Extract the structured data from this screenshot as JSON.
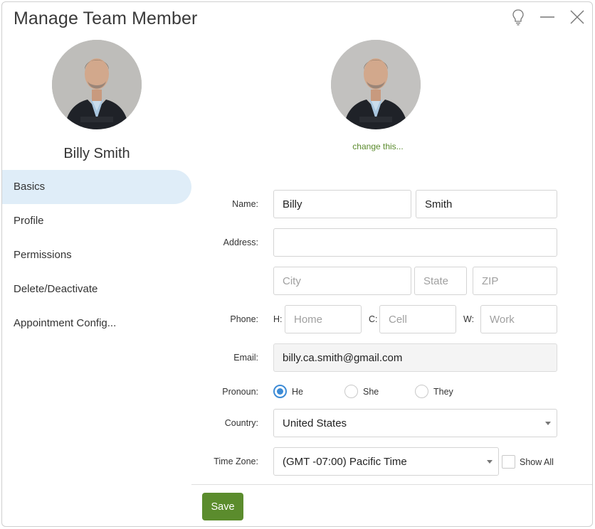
{
  "window": {
    "title": "Manage Team Member",
    "icons": [
      "lightbulb-icon",
      "minimize-icon",
      "close-icon"
    ]
  },
  "sidebar": {
    "member_name": "Billy Smith",
    "items": [
      {
        "label": "Basics",
        "active": true
      },
      {
        "label": "Profile",
        "active": false
      },
      {
        "label": "Permissions",
        "active": false
      },
      {
        "label": "Delete/Deactivate",
        "active": false
      },
      {
        "label": "Appointment Config...",
        "active": false
      }
    ]
  },
  "photo": {
    "change_label": "change this..."
  },
  "form": {
    "name": {
      "label": "Name:",
      "first": "Billy",
      "last": "Smith"
    },
    "address": {
      "label": "Address:",
      "street": "",
      "city_placeholder": "City",
      "state_placeholder": "State",
      "zip_placeholder": "ZIP"
    },
    "phone": {
      "label": "Phone:",
      "home_prefix": "H:",
      "home_placeholder": "Home",
      "cell_prefix": "C:",
      "cell_placeholder": "Cell",
      "work_prefix": "W:",
      "work_placeholder": "Work"
    },
    "email": {
      "label": "Email:",
      "value": "billy.ca.smith@gmail.com"
    },
    "pronoun": {
      "label": "Pronoun:",
      "options": [
        "He",
        "She",
        "They"
      ],
      "selected": "He"
    },
    "country": {
      "label": "Country:",
      "value": "United States"
    },
    "timezone": {
      "label": "Time Zone:",
      "value": "(GMT -07:00) Pacific Time",
      "show_all_label": "Show All",
      "show_all_checked": false
    }
  },
  "actions": {
    "save_label": "Save"
  },
  "colors": {
    "accent_blue": "#3c8bd6",
    "active_nav_bg": "#dfedf8",
    "save_green": "#5b8c2d",
    "link_green": "#5a8a2c"
  }
}
